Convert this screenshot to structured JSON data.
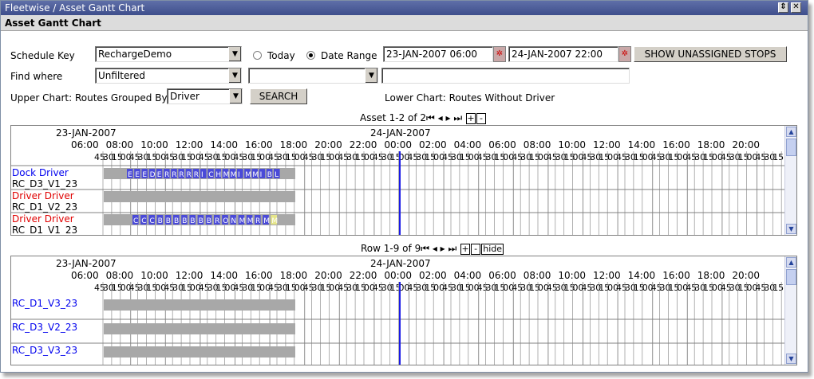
{
  "window": {
    "title": "Fleetwise / Asset Gantt Chart",
    "header": "Asset Gantt Chart",
    "restore_glyph": "⇕",
    "close_glyph": "✕"
  },
  "form": {
    "schedule_key_label": "Schedule Key",
    "schedule_key_value": "RechargeDemo",
    "today_label": "Today",
    "date_range_label": "Date Range",
    "date_from": "23-JAN-2007 06:00",
    "date_to": "24-JAN-2007 22:00",
    "show_unassigned_label": "SHOW UNASSIGNED STOPS",
    "find_where_label": "Find where",
    "find_where_value": "Unfiltered",
    "find_field_value": "",
    "find_text_value": "",
    "upper_chart_label": "Upper Chart: Routes Grouped By",
    "group_by_value": "Driver",
    "search_label": "SEARCH",
    "lower_chart_label": "Lower Chart: Routes Without Driver"
  },
  "upper_pager": {
    "text": "Asset 1-2 of 2",
    "plus": "+",
    "minus": "-"
  },
  "lower_pager": {
    "text": "Row 1-9 of 9",
    "plus": "+",
    "minus": "-",
    "hide": "hide"
  },
  "timeline": {
    "date1": "23-JAN-2007",
    "date2": "24-JAN-2007",
    "hours": [
      "06:00",
      "08:00",
      "10:00",
      "12:00",
      "14:00",
      "16:00",
      "18:00",
      "20:00",
      "22:00",
      "00:00",
      "02:00",
      "04:00",
      "06:00",
      "08:00",
      "10:00",
      "12:00",
      "14:00",
      "16:00",
      "18:00",
      "20:00"
    ],
    "minute_ticks": [
      "45",
      "30",
      "15",
      "00"
    ]
  },
  "upper_rows": [
    {
      "group": "Dock Driver",
      "group_color": "#0000ee",
      "asset": "RC_D3_V1_23",
      "stops": [
        "E",
        "E",
        "E",
        "D",
        "E",
        "R",
        "R",
        "R",
        "R",
        "R",
        "I",
        "C",
        "H",
        "M",
        "M",
        "I",
        "M",
        "M",
        "I",
        "B",
        "L"
      ]
    },
    {
      "group": "Driver Driver",
      "group_color": "#e00000",
      "asset": "RC_D1_V2_23",
      "stops": []
    },
    {
      "group": "Driver Driver",
      "group_color": "#e00000",
      "asset": "RC_D1_V1_23",
      "stops": [
        "C",
        "C",
        "C",
        "B",
        "B",
        "B",
        "B",
        "B",
        "B",
        "B",
        "R",
        "O",
        "N",
        "M",
        "M",
        "R",
        "M",
        "M"
      ]
    }
  ],
  "lower_rows": [
    {
      "label": "RC_D1_V3_23"
    },
    {
      "label": "RC_D3_V2_23"
    },
    {
      "label": "RC_D3_V3_23"
    }
  ],
  "colors": {
    "route_bar": "#a8a8a8",
    "stop": "#4a4ad8",
    "stop_highlight": "#e6e68a",
    "now_line": "#1a1ae6",
    "grid": "#808080"
  },
  "icons": {
    "calendar": "calendar-icon",
    "dropdown": "chevron-down-icon",
    "first": "first-page-icon",
    "prev": "prev-page-icon",
    "next": "next-page-icon",
    "last": "last-page-icon"
  }
}
